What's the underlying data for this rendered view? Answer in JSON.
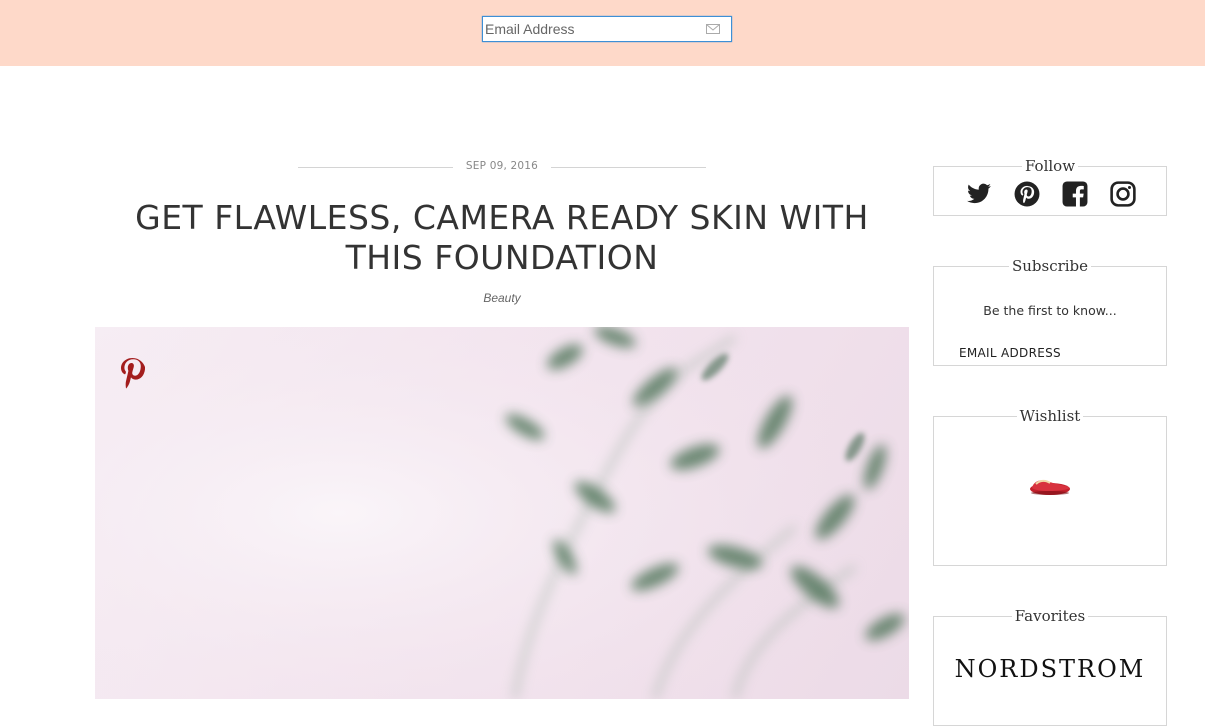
{
  "topbar": {
    "email_placeholder": "Email Address",
    "submit_icon": "envelope-icon"
  },
  "post": {
    "date": "SEP 09, 2016",
    "title_line1": "GET FLAWLESS, CAMERA READY SKIN WITH",
    "title_line2": "THIS FOUNDATION",
    "category": "Beauty",
    "pin_icon": "pinterest-icon"
  },
  "sidebar": {
    "follow": {
      "title": "Follow",
      "icons": [
        "twitter-icon",
        "pinterest-icon",
        "facebook-icon",
        "instagram-icon"
      ]
    },
    "subscribe": {
      "title": "Subscribe",
      "text": "Be the first to know...",
      "email_placeholder": "EMAIL ADDRESS"
    },
    "wishlist": {
      "title": "Wishlist",
      "item_icon": "slipper-image"
    },
    "favorites": {
      "title": "Favorites",
      "brand": "NORDSTROM"
    }
  },
  "colors": {
    "topbar_bg": "#fed9c9",
    "pin_red": "#a31d1d",
    "input_border": "#3d8fd6",
    "widget_border": "#d6d6d6"
  }
}
